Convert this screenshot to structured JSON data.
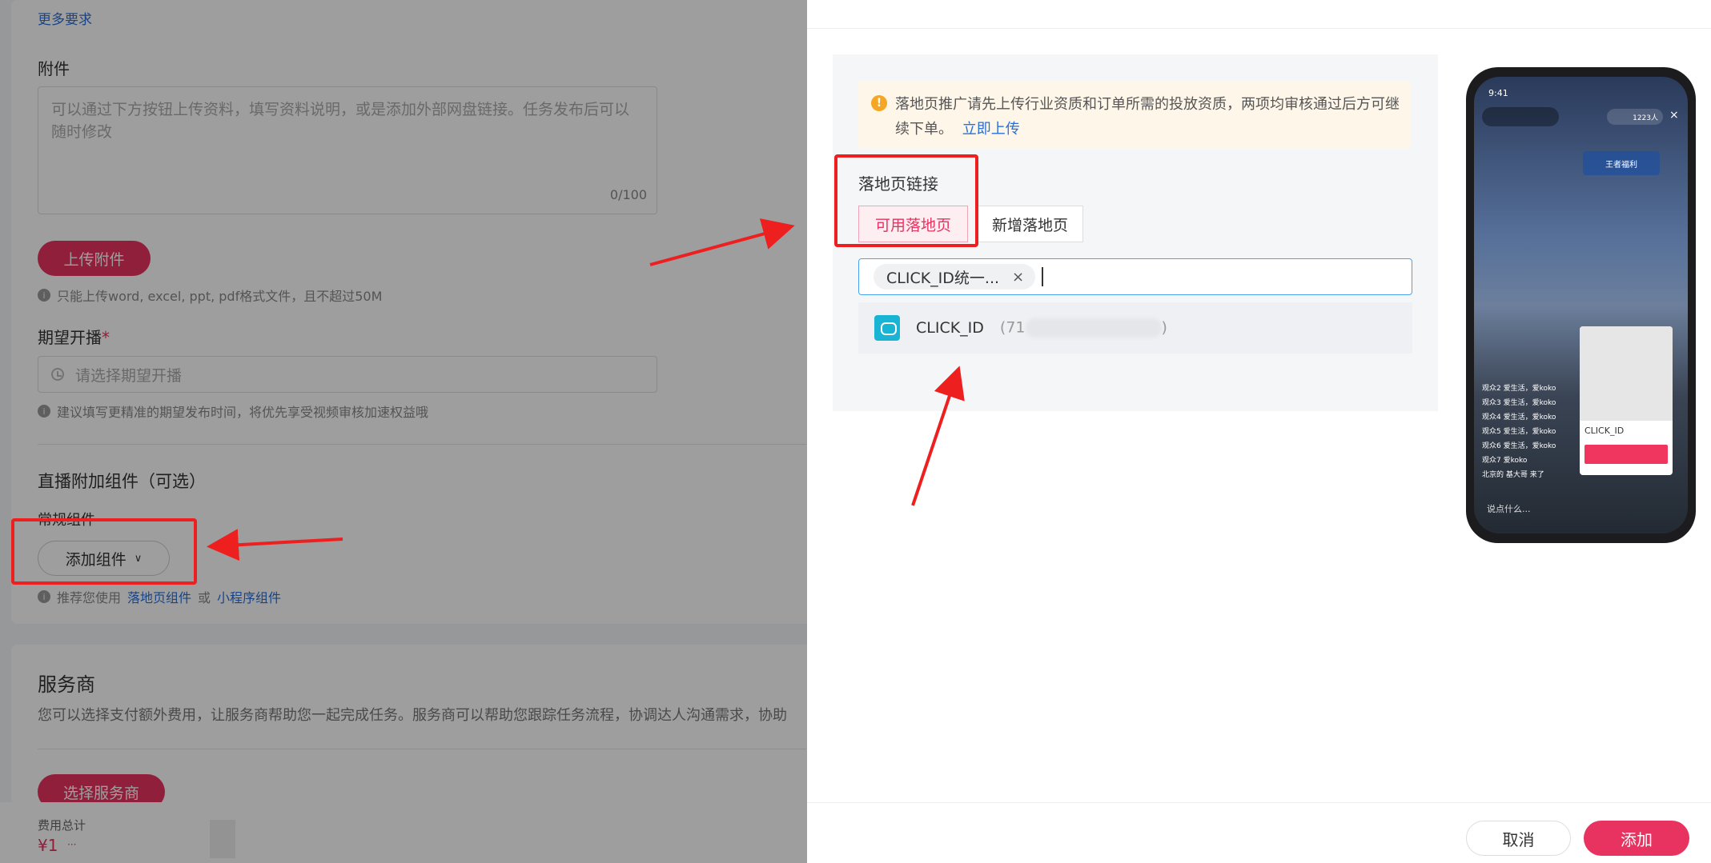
{
  "background_form": {
    "top_link": "更多要求",
    "attachment": {
      "label": "附件",
      "placeholder": "可以通过下方按钮上传资料，填写资料说明，或是添加外部网盘链接。任务发布后可以随时修改",
      "counter": "0/100",
      "upload_button": "上传附件",
      "tip": "只能上传word, excel, ppt, pdf格式文件，且不超过50M"
    },
    "expected_start": {
      "label": "期望开播",
      "required_mark": "*",
      "placeholder": "请选择期望开播",
      "tip": "建议填写更精准的期望发布时间，将优先享受视频审核加速权益哦"
    },
    "live_addon": {
      "title": "直播附加组件（可选）",
      "sub_label": "常规组件",
      "add_button": "添加组件",
      "tip_prefix": "推荐您使用",
      "tip_link1": "落地页组件",
      "tip_mid": "或",
      "tip_link2": "小程序组件"
    },
    "service": {
      "title": "服务商",
      "desc": "您可以选择支付额外费用，让服务商帮助您一起完成任务。服务商可以帮助您跟踪任务流程，协调达人沟通需求，协助",
      "button": "选择服务商"
    },
    "footer": {
      "total_label": "费用总计",
      "total_value": "¥1",
      "more": "···"
    }
  },
  "drawer": {
    "notice": {
      "text": "落地页推广请先上传行业资质和订单所需的投放资质，两项均审核通过后方可继续下单。",
      "link": "立即上传"
    },
    "landing_link_label": "落地页链接",
    "tabs": [
      "可用落地页",
      "新增落地页"
    ],
    "selected_chip": "CLICK_ID统一...",
    "chip_remove": "×",
    "option": {
      "name": "CLICK_ID",
      "id_prefix": "(71",
      "id_suffix": ")"
    },
    "buttons": {
      "cancel": "取消",
      "add": "添加"
    }
  },
  "phone_preview": {
    "time": "9:41",
    "audience_count": "1223人",
    "close": "×",
    "tag_text": "王者福利",
    "card_title": "CLICK_ID",
    "input_placeholder": "说点什么...",
    "chat_lines": [
      "观众2 爱生活，爱koko",
      "观众3 爱生活，爱koko",
      "观众4 爱生活，爱koko",
      "观众5 爱生活，爱koko",
      "观众6 爱生活，爱koko",
      "观众7 爱koko",
      "北京的 基大哥 来了"
    ]
  },
  "colors": {
    "brand": "#e8325f",
    "annotation_red": "#ee1f1f",
    "link_blue": "#2a6ed8",
    "notice_bg": "#fef6e9"
  }
}
